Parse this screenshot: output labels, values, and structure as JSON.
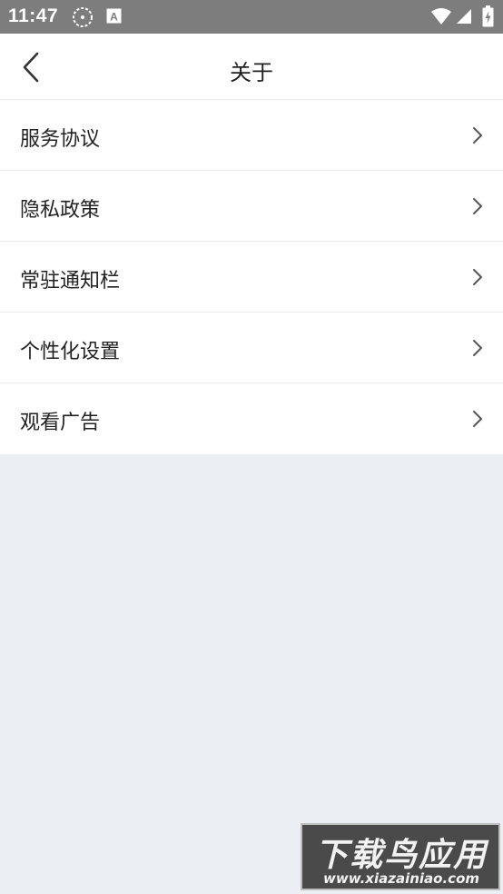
{
  "status_bar": {
    "time": "11:47",
    "icons": [
      "sync-icon",
      "a-badge-icon",
      "wifi-icon",
      "signal-icon",
      "battery-icon"
    ]
  },
  "header": {
    "title": "关于",
    "back_icon": "chevron-left-icon"
  },
  "menu": {
    "items": [
      {
        "label": "服务协议"
      },
      {
        "label": "隐私政策"
      },
      {
        "label": "常驻通知栏"
      },
      {
        "label": "个性化设置"
      },
      {
        "label": "观看广告"
      }
    ]
  },
  "watermark": {
    "title": "下载鸟应用",
    "url": "www.xiazainiao.com"
  },
  "colors": {
    "status_bar": "#7d7d7d",
    "background": "#ebeef2",
    "surface": "#ffffff",
    "text": "#222222",
    "chevron": "#555555"
  }
}
